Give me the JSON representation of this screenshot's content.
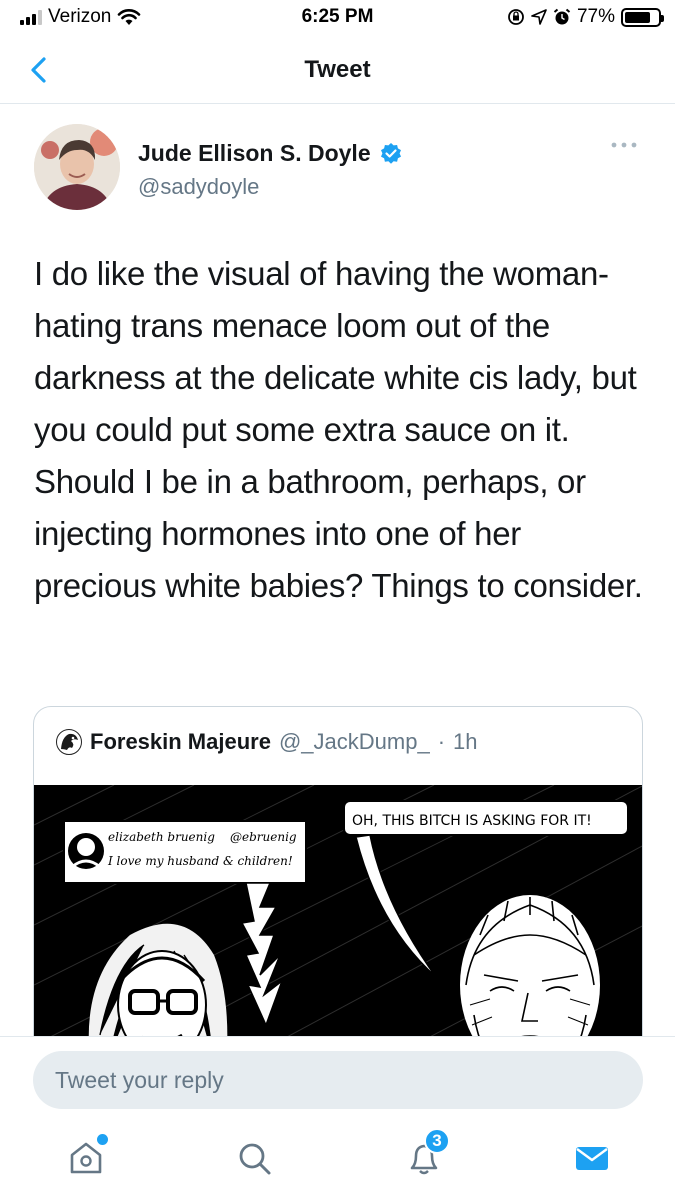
{
  "status_bar": {
    "carrier": "Verizon",
    "time": "6:25 PM",
    "battery_percent": "77%",
    "battery_level": 0.77,
    "icons": [
      "signal-icon",
      "wifi-icon",
      "orientation-lock-icon",
      "location-icon",
      "alarm-icon",
      "battery-icon"
    ]
  },
  "nav": {
    "title": "Tweet",
    "back_icon": "chevron-left-icon"
  },
  "tweet": {
    "author_name": "Jude Ellison S. Doyle",
    "author_handle": "@sadydoyle",
    "verified": true,
    "text": "I do like the visual of having the woman-hating trans menace loom out of the darkness at the delicate white cis lady, but you could put some extra sauce on it. Should I be in a bathroom, perhaps, or injecting hormones into one of her precious white babies? Things to consider.",
    "more_icon": "more-options-icon"
  },
  "quote": {
    "author_name": "Foreskin Majeure",
    "author_handle": "@_JackDump_",
    "separator": "·",
    "time_ago": "1h",
    "comic": {
      "caption_name": "elizabeth bruenig",
      "caption_handle": "@ebruenig",
      "caption_bio": "I love my husband & children!",
      "speech": "OH, THIS BITCH IS ASKING FOR IT!"
    }
  },
  "reply": {
    "placeholder": "Tweet your reply"
  },
  "tabs": [
    {
      "name": "home",
      "icon": "home-icon",
      "has_dot": true
    },
    {
      "name": "search",
      "icon": "search-icon"
    },
    {
      "name": "notifications",
      "icon": "bell-icon",
      "badge": "3"
    },
    {
      "name": "messages",
      "icon": "mail-icon"
    }
  ],
  "colors": {
    "accent": "#1da1f2",
    "text": "#14171a",
    "secondary": "#657786",
    "divider": "#e1e8ed"
  }
}
